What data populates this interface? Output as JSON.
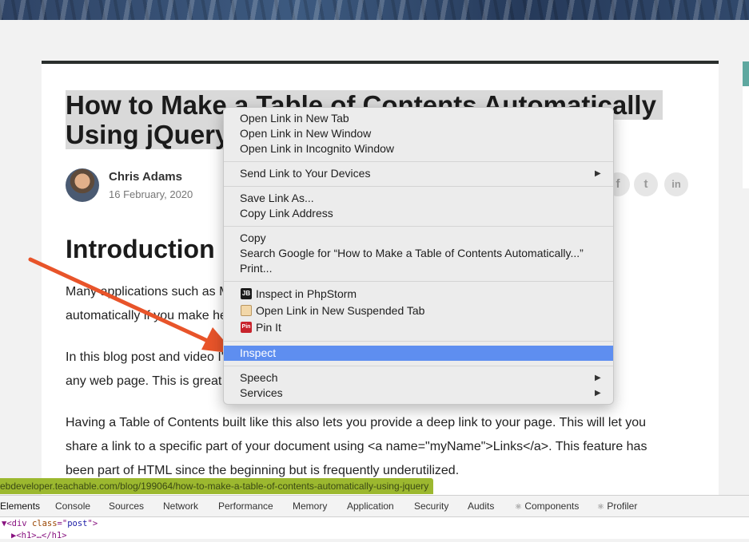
{
  "article": {
    "title": "How to Make a Table of Contents Automatically Using jQuery",
    "author_name": "Chris Adams",
    "author_date": "16 February, 2020",
    "section_heading": "Introduction",
    "para1_line1": "Many applications such as Microsoft Word or Google Docs build Tables of Contents",
    "para1_line2": "automatically if you make headings in your document.",
    "para2_line1": "In this blog post and video I'll show you how to build a script that will do it for you on",
    "para2_line2": "any web page. This is great for longer pages, blog posts and documentation.",
    "para3_line1": "Having a Table of Contents built like this also lets you provide a deep link to your page. This will let you",
    "para3_line2": "share a link to a specific part of your document using <a name=\"myName\">Links</a>. This feature has",
    "para3_line3": "been part of HTML since the beginning but is frequently underutilized."
  },
  "socials": {
    "facebook": "f",
    "twitter": "t",
    "linkedin": "in",
    "icons": [
      "facebook-icon",
      "twitter-icon",
      "linkedin-icon"
    ]
  },
  "status_url": "ebdeveloper.teachable.com/blog/199064/how-to-make-a-table-of-contents-automatically-using-jquery",
  "devtools": {
    "tabs": [
      "Elements",
      "Console",
      "Sources",
      "Network",
      "Performance",
      "Memory",
      "Application",
      "Security",
      "Audits",
      "Components",
      "Profiler"
    ],
    "components_prefix": "⚛",
    "profiler_prefix": "⚛",
    "line1_tag_open": "▼<div ",
    "line1_attr": "class",
    "line1_eq": "=\"",
    "line1_val": "post",
    "line1_close": "\">",
    "line2": "▶<h1>…</h1>"
  },
  "context_menu": {
    "open_new_tab": "Open Link in New Tab",
    "open_new_window": "Open Link in New Window",
    "open_incognito": "Open Link in Incognito Window",
    "send_to_devices": "Send Link to Your Devices",
    "save_link_as": "Save Link As...",
    "copy_link_address": "Copy Link Address",
    "copy": "Copy",
    "search_google": "Search Google for “How to Make a Table of Contents Automatically...”",
    "print": "Print...",
    "inspect_phpstorm": "Inspect in PhpStorm",
    "open_suspended": "Open Link in New Suspended Tab",
    "pin_it": "Pin It",
    "inspect": "Inspect",
    "speech": "Speech",
    "services": "Services",
    "phpstorm_badge": "JB",
    "pin_badge": "Pin",
    "submenu_arrow": "▶"
  },
  "colors": {
    "highlight": "#5e8ef0",
    "arrow": "#e8542a",
    "url_bar": "#9cb82f"
  }
}
